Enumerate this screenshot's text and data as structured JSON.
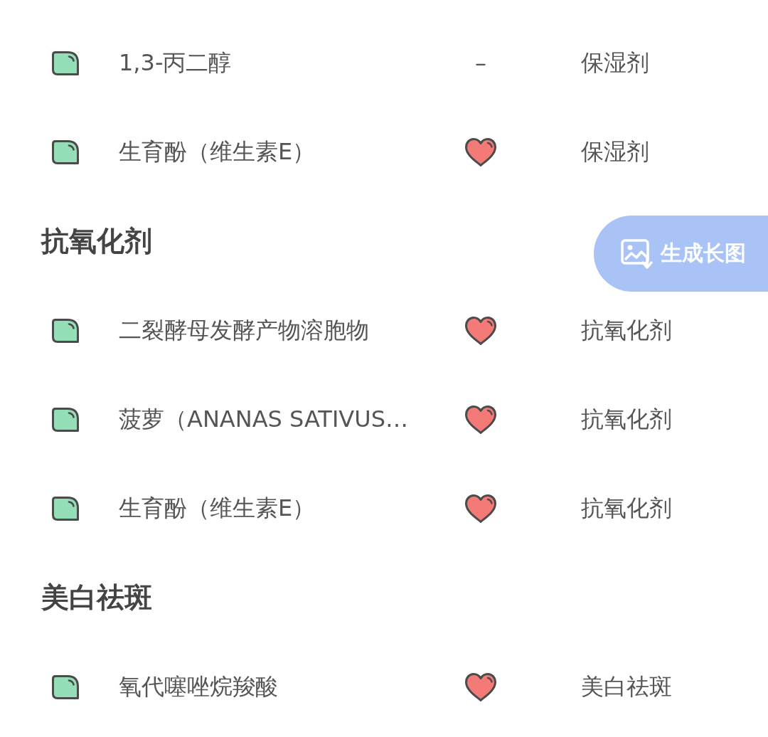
{
  "sections": [
    {
      "items": [
        {
          "name": "1,3-丙二醇",
          "indicator": {
            "kind": "dash",
            "text": "–"
          },
          "purpose": "保湿剂"
        },
        {
          "name": "生育酚（维生素E）",
          "indicator": {
            "kind": "heart"
          },
          "purpose": "保湿剂"
        }
      ]
    },
    {
      "heading": "抗氧化剂",
      "items": [
        {
          "name": "二裂酵母发酵产物溶胞物",
          "indicator": {
            "kind": "heart"
          },
          "purpose": "抗氧化剂"
        },
        {
          "name": "菠萝（ANANAS SATIVUS…",
          "indicator": {
            "kind": "heart"
          },
          "purpose": "抗氧化剂"
        },
        {
          "name": "生育酚（维生素E）",
          "indicator": {
            "kind": "heart"
          },
          "purpose": "抗氧化剂"
        }
      ]
    },
    {
      "heading": "美白祛斑",
      "items": [
        {
          "name": "氧代噻唑烷羧酸",
          "indicator": {
            "kind": "heart"
          },
          "purpose": "美白祛斑"
        }
      ]
    }
  ],
  "floating_button": {
    "label": "生成长图"
  }
}
